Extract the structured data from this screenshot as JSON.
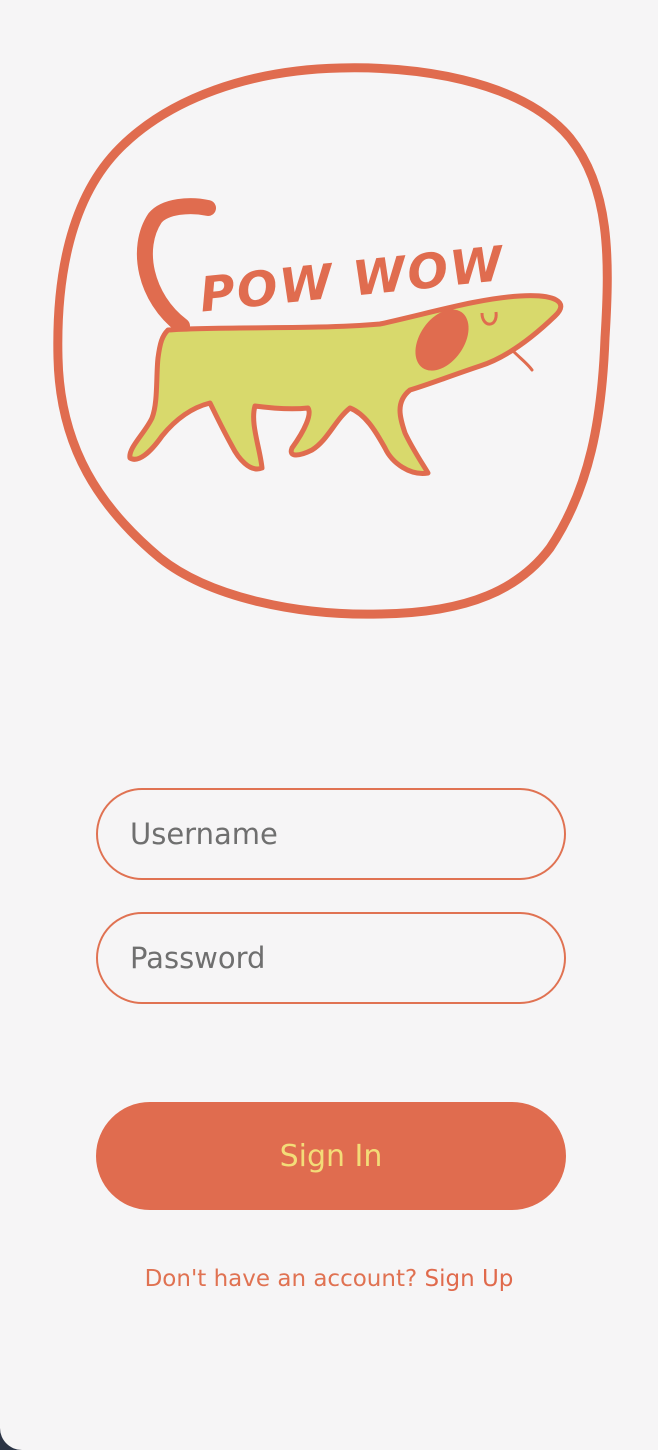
{
  "logo": {
    "text": "POW WOW",
    "ring_color": "#e06c4f",
    "dog_color": "#d8d96c"
  },
  "login_form": {
    "username_placeholder": "Username",
    "password_placeholder": "Password",
    "sign_in_label": "Sign In"
  },
  "footer": {
    "prompt": "Don't have an account?",
    "sign_up_label": "Sign Up"
  },
  "colors": {
    "accent": "#e06c4f",
    "button_text": "#f3dc78",
    "background": "#f6f5f6"
  }
}
